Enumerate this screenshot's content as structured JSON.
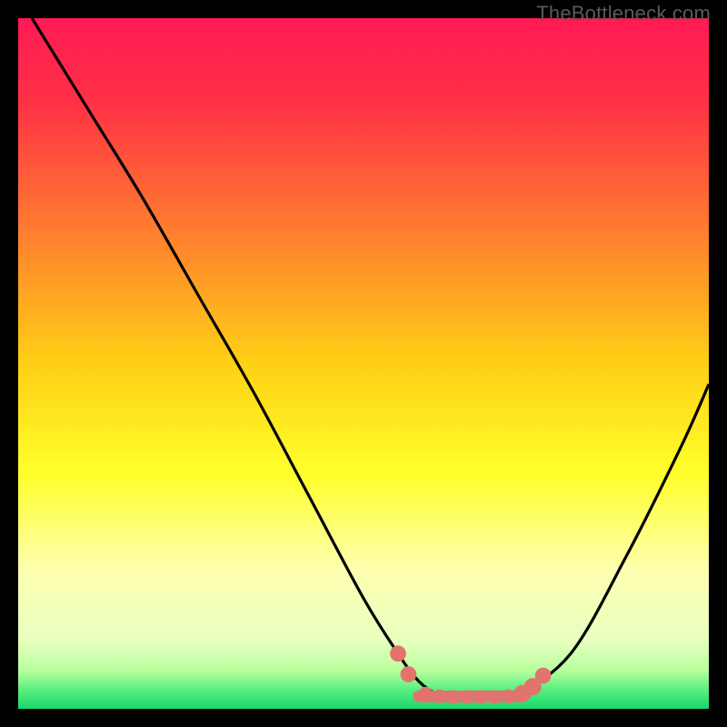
{
  "watermark": "TheBottleneck.com",
  "chart_data": {
    "type": "line",
    "title": "",
    "xlabel": "",
    "ylabel": "",
    "xlim": [
      0,
      100
    ],
    "ylim": [
      0,
      100
    ],
    "gradient_stops": [
      {
        "offset": 0,
        "color": "#ff1a55"
      },
      {
        "offset": 0.12,
        "color": "#ff3045"
      },
      {
        "offset": 0.3,
        "color": "#ff7a30"
      },
      {
        "offset": 0.5,
        "color": "#ffd015"
      },
      {
        "offset": 0.66,
        "color": "#ffff2a"
      },
      {
        "offset": 0.8,
        "color": "#fdffb0"
      },
      {
        "offset": 0.9,
        "color": "#e9ffbf"
      },
      {
        "offset": 0.945,
        "color": "#b8ff9e"
      },
      {
        "offset": 0.97,
        "color": "#60f083"
      },
      {
        "offset": 1.0,
        "color": "#17d96a"
      }
    ],
    "series": [
      {
        "name": "bottleneck-curve",
        "stroke": "#000000",
        "x": [
          2,
          10,
          18,
          26,
          34,
          42,
          50,
          55,
          58,
          61,
          64,
          68,
          72,
          80,
          88,
          96,
          100
        ],
        "y": [
          100,
          87,
          74,
          60,
          46,
          31,
          16,
          8,
          4,
          2,
          2,
          2,
          2,
          8,
          22,
          38,
          47
        ]
      }
    ],
    "markers": {
      "name": "valley-markers",
      "color": "#e2746e",
      "points": [
        {
          "x": 55.0,
          "y": 8.0,
          "r": 1.3
        },
        {
          "x": 56.5,
          "y": 5.0,
          "r": 1.3
        },
        {
          "x": 59.0,
          "y": 2.2,
          "r": 1.1
        },
        {
          "x": 61.0,
          "y": 1.8,
          "r": 1.1
        },
        {
          "x": 63.0,
          "y": 1.7,
          "r": 1.1
        },
        {
          "x": 65.0,
          "y": 1.7,
          "r": 1.1
        },
        {
          "x": 67.0,
          "y": 1.7,
          "r": 1.1
        },
        {
          "x": 69.0,
          "y": 1.7,
          "r": 1.1
        },
        {
          "x": 71.0,
          "y": 1.8,
          "r": 1.1
        },
        {
          "x": 73.0,
          "y": 2.2,
          "r": 1.4
        },
        {
          "x": 74.5,
          "y": 3.2,
          "r": 1.4
        },
        {
          "x": 76.0,
          "y": 4.8,
          "r": 1.3
        }
      ],
      "segment": {
        "x0": 58,
        "x1": 73,
        "y": 1.8
      }
    }
  }
}
